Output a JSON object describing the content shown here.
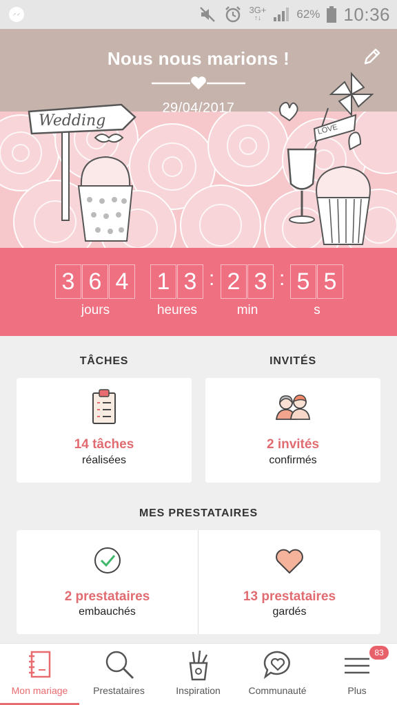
{
  "status_bar": {
    "time": "10:36",
    "battery": "62%",
    "network": "3G+",
    "network_sub": "↑↓"
  },
  "hero": {
    "title": "Nous nous marions !",
    "date": "29/04/2017",
    "sign_text": "Wedding",
    "flag_text": "LOVE"
  },
  "countdown": {
    "days": [
      "3",
      "6",
      "4"
    ],
    "hours": [
      "1",
      "3"
    ],
    "minutes": [
      "2",
      "3"
    ],
    "seconds": [
      "5",
      "5"
    ],
    "separator": ":",
    "labels": {
      "days": "jours",
      "hours": "heures",
      "minutes": "min",
      "seconds": "s"
    }
  },
  "sections": {
    "taches": {
      "title": "TÂCHES",
      "main": "14 tâches",
      "sub": "réalisées"
    },
    "invites": {
      "title": "INVITÉS",
      "main": "2 invités",
      "sub": "confirmés"
    },
    "prestataires": {
      "title": "MES PRESTATAIRES",
      "hired_main": "2 prestataires",
      "hired_sub": "embauchés",
      "saved_main": "13 prestataires",
      "saved_sub": "gardés"
    }
  },
  "nav": {
    "items": [
      {
        "label": "Mon mariage",
        "icon": "notebook-icon"
      },
      {
        "label": "Prestataires",
        "icon": "search-icon"
      },
      {
        "label": "Inspiration",
        "icon": "pencil-cup-icon"
      },
      {
        "label": "Communauté",
        "icon": "chat-heart-icon"
      },
      {
        "label": "Plus",
        "icon": "menu-icon"
      }
    ],
    "badge": "83"
  },
  "colors": {
    "accent": "#ef7081",
    "hero_bg": "#c5b3ac",
    "text_accent": "#e06b70"
  }
}
